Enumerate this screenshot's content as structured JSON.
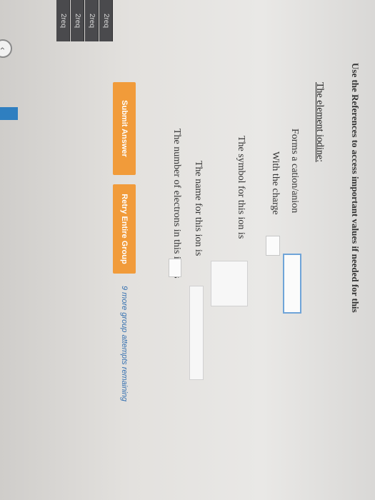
{
  "sidebar": {
    "tabs": [
      "2req",
      "2req",
      "2req",
      "2req"
    ]
  },
  "header": {
    "references_text": "Use the References to access important values if needed for this"
  },
  "question": {
    "heading": "The element iodine:",
    "cation_anion_label": "Forms a cation/anion",
    "charge_label": "With the charge",
    "symbol_label": "The symbol for this ion is",
    "name_label": "The name for this ion is",
    "electrons_label": "The number of electrons in this ion is"
  },
  "actions": {
    "submit_label": "Submit Answer",
    "retry_label": "Retry Entire Group",
    "attempts_text": "9 more group attempts remaining"
  },
  "icons": {
    "collapse": "chevron-left-icon"
  },
  "colors": {
    "button": "#f19b3a",
    "input_border": "#6fa4d8",
    "attempts_text": "#3570b0"
  }
}
